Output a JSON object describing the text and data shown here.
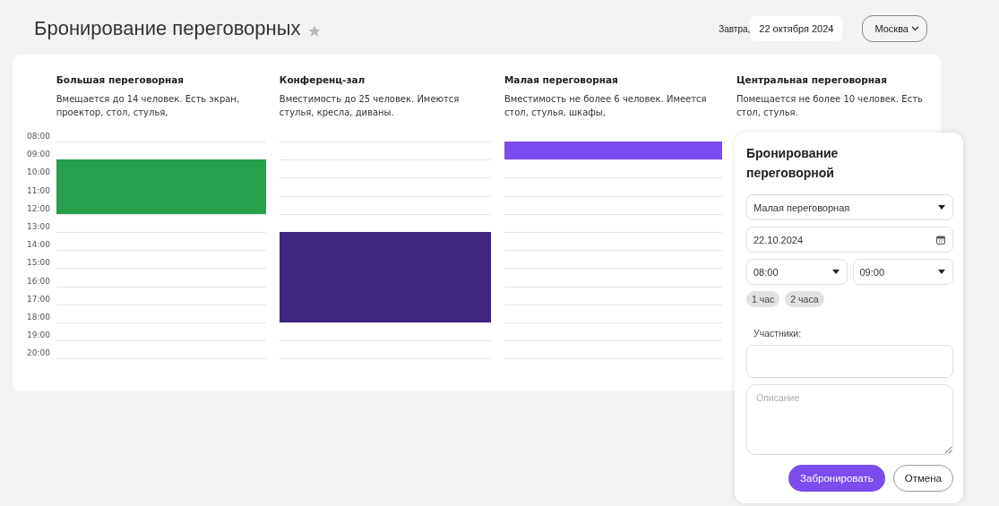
{
  "header": {
    "title": "Бронирование переговорных",
    "favorite": false,
    "date_prefix": "Завтра,",
    "date": "22 октября 2024",
    "city": "Москва"
  },
  "hours": [
    "08:00",
    "09:00",
    "10:00",
    "11:00",
    "12:00",
    "13:00",
    "14:00",
    "15:00",
    "16:00",
    "17:00",
    "18:00",
    "19:00",
    "20:00"
  ],
  "rooms": [
    {
      "name": "Большая переговорная",
      "description": "Вмещается до 14 человек. Есть экран, проектор, стол, стулья,",
      "color": "#26a04a",
      "slots": [
        {
          "booked": false
        },
        {
          "booked": true
        },
        {
          "booked": true
        },
        {
          "booked": true
        },
        {
          "booked": false
        },
        {
          "booked": false
        },
        {
          "booked": false
        },
        {
          "booked": false
        },
        {
          "booked": false
        },
        {
          "booked": false
        },
        {
          "booked": false
        },
        {
          "booked": false
        }
      ]
    },
    {
      "name": "Конференц-зал",
      "description": "Вместимость до 25 человек. Имеются стулья, кресла, диваны.",
      "color": "#3f2680",
      "slots": [
        {
          "booked": false
        },
        {
          "booked": false
        },
        {
          "booked": false
        },
        {
          "booked": false
        },
        {
          "booked": false
        },
        {
          "booked": true
        },
        {
          "booked": true
        },
        {
          "booked": true
        },
        {
          "booked": true
        },
        {
          "booked": true
        },
        {
          "booked": false
        },
        {
          "booked": false
        }
      ]
    },
    {
      "name": "Малая переговорная",
      "description": "Вместимость не более 6 человек. Имеется стол, стулья, шкафы,",
      "color": "#7c4dee",
      "slots": [
        {
          "booked": true
        },
        {
          "booked": false
        },
        {
          "booked": false
        },
        {
          "booked": false
        },
        {
          "booked": false
        },
        {
          "booked": false
        },
        {
          "booked": false
        },
        {
          "booked": false
        },
        {
          "booked": false
        },
        {
          "booked": false
        },
        {
          "booked": false
        },
        {
          "booked": false
        }
      ]
    },
    {
      "name": "Центральная переговорная",
      "description": "Помещается не более 10 человек. Есть стол, стулья."
    }
  ],
  "booking_form": {
    "title": "Бронирование переговорной",
    "room": "Малая переговорная",
    "date": "22.10.2024",
    "time_from": "08:00",
    "time_to": "09:00",
    "durations": [
      {
        "label": "1 час",
        "selected": false
      },
      {
        "label": "2 часа",
        "selected": false
      }
    ],
    "participants_label": "Участники:",
    "description_placeholder": "Описание",
    "submit": "Забронировать",
    "cancel": "Отмена"
  }
}
